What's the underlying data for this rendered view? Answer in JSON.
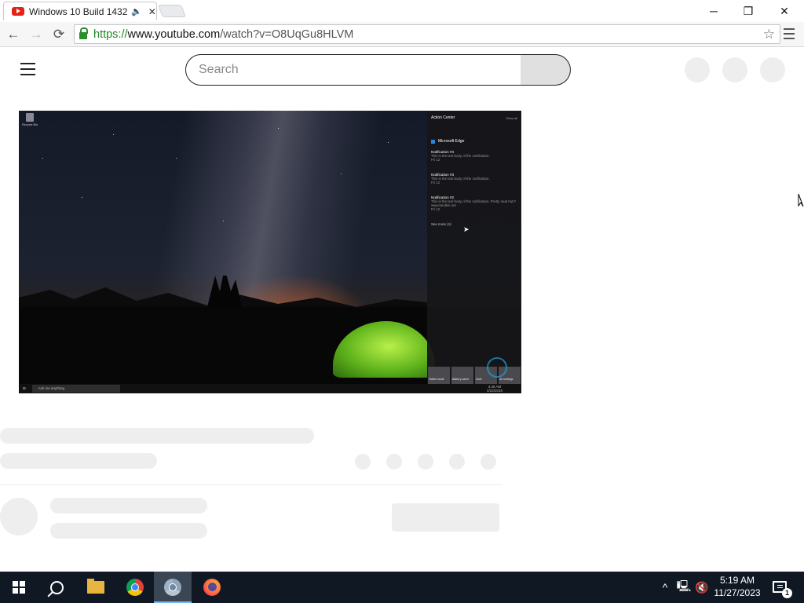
{
  "browser": {
    "tab": {
      "title": "Windows 10 Build 1432",
      "favicon": "youtube-icon",
      "audio_icon": "speaker-icon",
      "close_icon": "close-icon"
    },
    "window_controls": {
      "minimize": "─",
      "restore": "❐",
      "close": "✕"
    },
    "url": {
      "scheme": "https://",
      "host": "www.youtube.com",
      "path": "/watch?v=O8UqGu8HLVM"
    },
    "lock_color": "#2c8c2c",
    "nav": {
      "back": "←",
      "forward": "→",
      "reload": "⟳",
      "bookmark": "☆"
    }
  },
  "youtube": {
    "search": {
      "placeholder": "Search"
    },
    "video": {
      "desktop": {
        "recycle_bin_label": "Recycle Bin",
        "action_center": {
          "title": "Action Center",
          "clear_all": "Clear all",
          "app": "Microsoft Edge",
          "notifications": [
            {
              "title": "Notification #4",
              "body": "This is the text body of the notification.",
              "time": "Fri 12"
            },
            {
              "title": "Notification #3",
              "body": "This is the text body of the notification.",
              "time": "Fri 12"
            },
            {
              "title": "Notification #2",
              "body": "This is the text body of the notification. Pretty neat huh?",
              "extra": "www.bestkin.net",
              "time": "Fri 12"
            }
          ],
          "see_more": "See more (1)",
          "quick_actions": [
            "Tablet mode",
            "Battery saver",
            "Note",
            "All settings"
          ]
        },
        "taskbar_search": "Ask me anything",
        "clock_time": "4:38 AM",
        "clock_date": "4/22/2016"
      }
    }
  },
  "taskbar": {
    "items": [
      "start-icon",
      "search-icon",
      "file-explorer-icon",
      "chrome-icon",
      "chrome-canary-icon",
      "firefox-icon"
    ],
    "clock": {
      "time": "5:19 AM",
      "date": "11/27/2023"
    },
    "notification_count": "1",
    "tray_chevron": "^"
  }
}
